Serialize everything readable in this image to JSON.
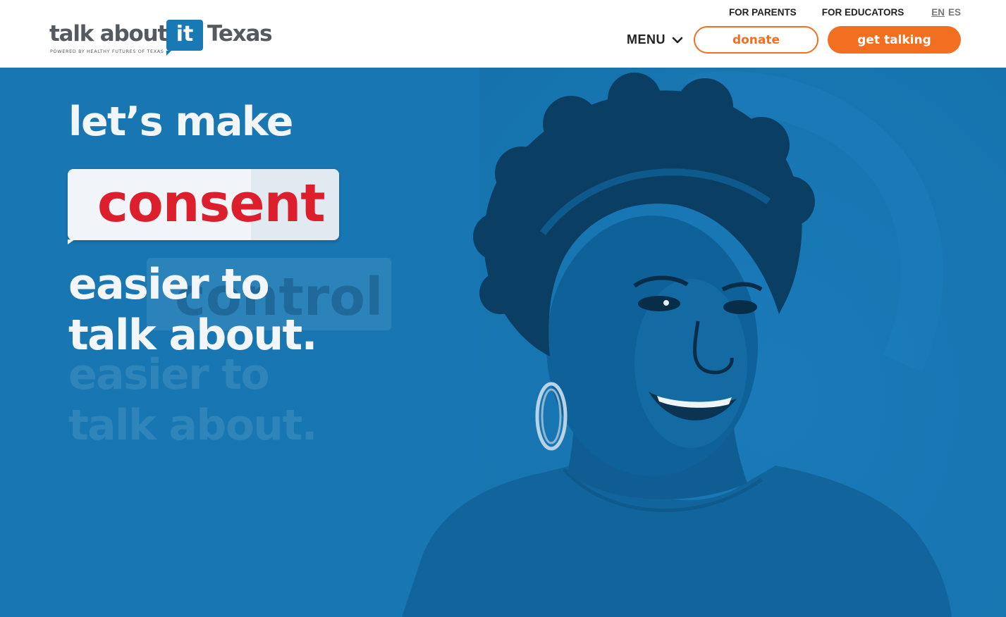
{
  "header": {
    "logo": {
      "talk_about": "talk about",
      "it": "it",
      "texas": "Texas",
      "tagline": "POWERED BY HEALTHY FUTURES OF TEXAS"
    },
    "utility_nav": {
      "for_parents": "FOR PARENTS",
      "for_educators": "FOR EDUCATORS",
      "lang_en": "EN",
      "lang_es": "ES"
    },
    "main_nav": {
      "menu": "MENU",
      "donate": "donate",
      "get_talking": "get talking"
    }
  },
  "hero": {
    "line1": "let’s make",
    "rotating_word": "consent",
    "ghost_word": "control",
    "line2": "easier to",
    "line3": "talk about.",
    "ghost_line2": "easier to",
    "ghost_line3": "talk about."
  },
  "colors": {
    "brand_blue": "#1879b5",
    "hero_blue": "#1877b3",
    "accent_orange": "#f26f21",
    "word_red": "#dc1e2d"
  }
}
